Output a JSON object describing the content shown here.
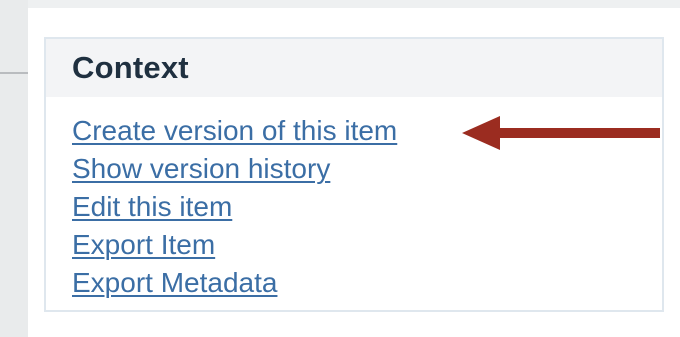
{
  "context_panel": {
    "title": "Context",
    "links": [
      {
        "label": "Create version of this item"
      },
      {
        "label": "Show version history"
      },
      {
        "label": "Edit this item"
      },
      {
        "label": "Export Item"
      },
      {
        "label": "Export Metadata"
      }
    ]
  },
  "annotation": {
    "arrow_color": "#9b2c20",
    "icon": "arrow-left-icon"
  },
  "colors": {
    "link": "#3b6ea5",
    "title": "#1f3040",
    "header_bg": "#f3f4f6",
    "panel_border": "#dfe7ee"
  }
}
